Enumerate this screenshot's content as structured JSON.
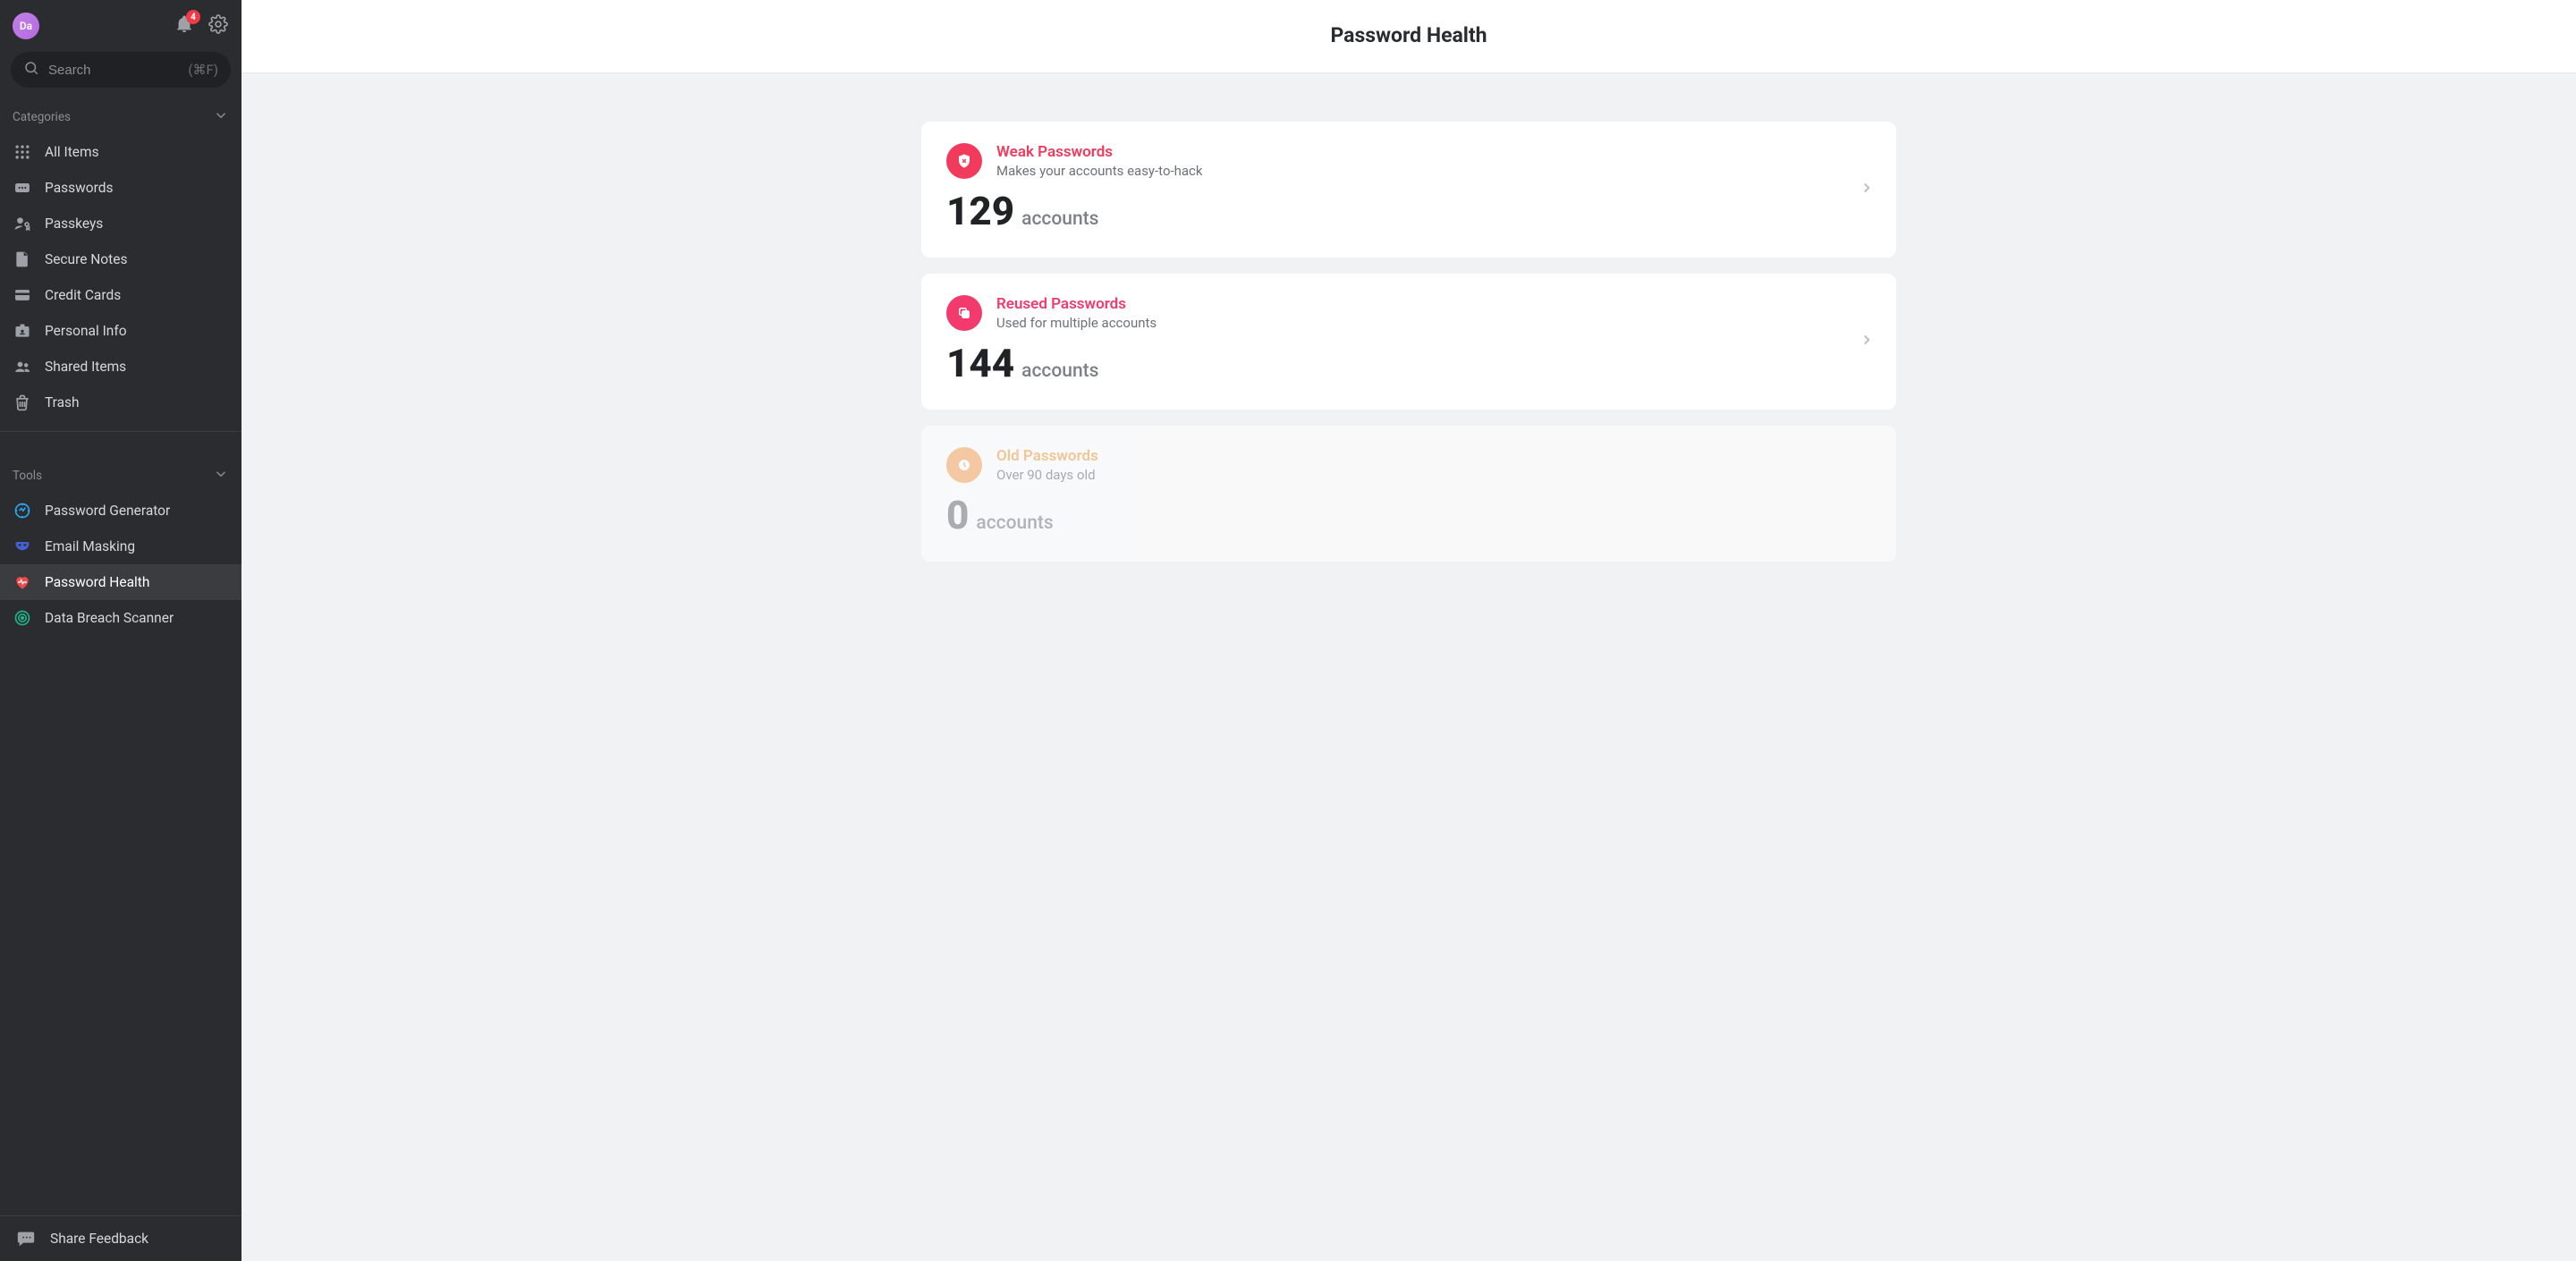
{
  "avatar_initials": "Da",
  "notifications_count": "4",
  "search": {
    "placeholder": "Search",
    "shortcut_hint": "(⌘F)"
  },
  "sections": {
    "categories_label": "Categories",
    "tools_label": "Tools"
  },
  "categories": [
    {
      "label": "All Items"
    },
    {
      "label": "Passwords"
    },
    {
      "label": "Passkeys"
    },
    {
      "label": "Secure Notes"
    },
    {
      "label": "Credit Cards"
    },
    {
      "label": "Personal Info"
    },
    {
      "label": "Shared Items"
    },
    {
      "label": "Trash"
    }
  ],
  "tools": [
    {
      "label": "Password Generator"
    },
    {
      "label": "Email Masking"
    },
    {
      "label": "Password Health"
    },
    {
      "label": "Data Breach Scanner"
    }
  ],
  "feedback_label": "Share Feedback",
  "page_title": "Password Health",
  "cards": [
    {
      "title": "Weak Passwords",
      "subtitle": "Makes your accounts easy-to-hack",
      "count": "129",
      "unit": "accounts"
    },
    {
      "title": "Reused Passwords",
      "subtitle": "Used for multiple accounts",
      "count": "144",
      "unit": "accounts"
    },
    {
      "title": "Old Passwords",
      "subtitle": "Over 90 days old",
      "count": "0",
      "unit": "accounts"
    }
  ]
}
